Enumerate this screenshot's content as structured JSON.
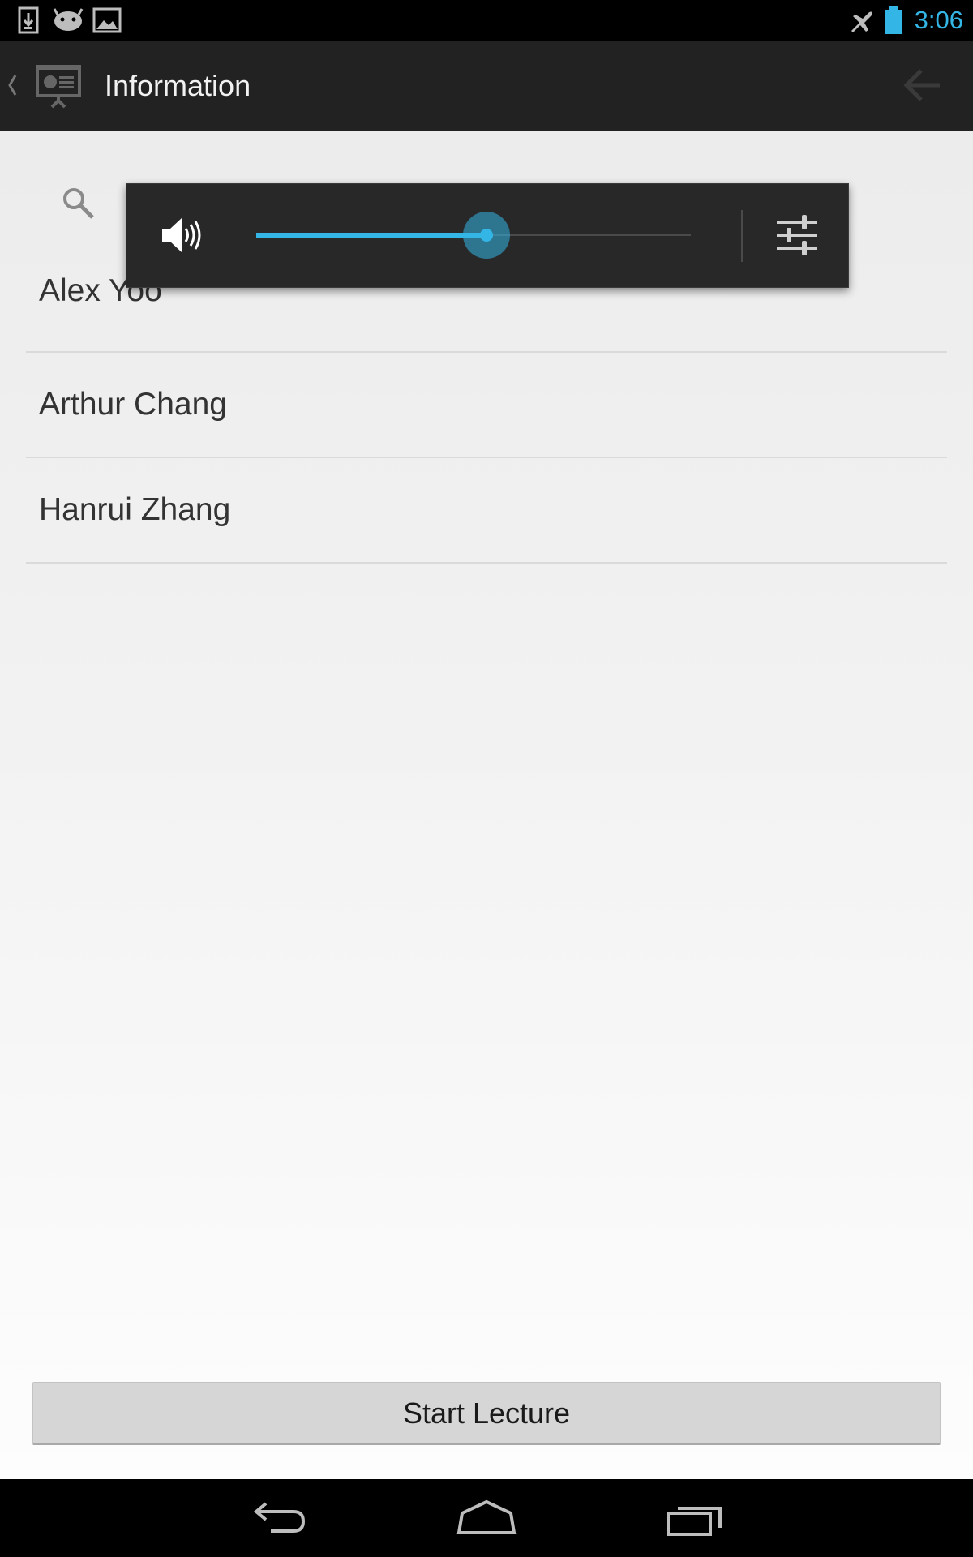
{
  "status_bar": {
    "clock": "3:06",
    "left_icons": [
      "download-icon",
      "android-icon",
      "image-icon"
    ],
    "right_icons": [
      "airplane-mode-icon",
      "battery-icon"
    ],
    "accent_color": "#33b5e5"
  },
  "action_bar": {
    "title": "Information",
    "up_icon": "presentation-icon",
    "back_icon": "arrow-left-icon"
  },
  "search": {
    "icon": "search-icon"
  },
  "people": [
    {
      "name": "Alex Yoo"
    },
    {
      "name": "Arthur Chang"
    },
    {
      "name": "Hanrui Zhang"
    }
  ],
  "volume_panel": {
    "speaker_icon": "speaker-icon",
    "settings_icon": "sliders-icon",
    "level_fraction": 0.53,
    "accent_color": "#33b5e5"
  },
  "footer": {
    "start_label": "Start Lecture"
  },
  "nav_bar": {
    "buttons": [
      "back-icon",
      "home-icon",
      "recent-apps-icon"
    ]
  }
}
